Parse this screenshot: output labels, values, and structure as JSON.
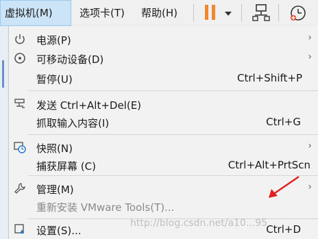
{
  "menubar": {
    "items": [
      {
        "label": "虚拟机(M)"
      },
      {
        "label": "选项卡(T)"
      },
      {
        "label": "帮助(H)"
      }
    ]
  },
  "toolbar": {
    "icons": [
      "pause-icon",
      "dropdown-caret-icon",
      "network-icon",
      "snapshot-clock-icon"
    ],
    "accent_color": "#f0882a"
  },
  "menu": {
    "items": [
      {
        "label": "电源(P)",
        "shortcut": "",
        "submenu": true,
        "icon": "power-icon"
      },
      {
        "label": "可移动设备(D)",
        "shortcut": "",
        "submenu": true,
        "icon": "removable-device-icon"
      },
      {
        "label": "暂停(U)",
        "shortcut": "Ctrl+Shift+P",
        "submenu": false,
        "icon": ""
      },
      {
        "label": "发送 Ctrl+Alt+Del(E)",
        "shortcut": "",
        "submenu": false,
        "icon": "send-keys-icon"
      },
      {
        "label": "抓取输入内容(I)",
        "shortcut": "Ctrl+G",
        "submenu": false,
        "icon": ""
      },
      {
        "label": "快照(N)",
        "shortcut": "",
        "submenu": true,
        "icon": "snapshot-icon"
      },
      {
        "label": "捕获屏幕 (C)",
        "shortcut": "Ctrl+Alt+PrtScn",
        "submenu": false,
        "icon": ""
      },
      {
        "label": "管理(M)",
        "shortcut": "",
        "submenu": true,
        "icon": "wrench-icon"
      },
      {
        "label": "重新安装 VMware Tools(T)...",
        "shortcut": "",
        "submenu": false,
        "disabled": true,
        "icon": ""
      },
      {
        "label": "设置(S)...",
        "shortcut": "Ctrl+D",
        "submenu": false,
        "icon": "settings-icon"
      }
    ]
  },
  "watermark": "http://blog.csdn.net/a10...95",
  "annotation": {
    "color": "#e02020"
  }
}
